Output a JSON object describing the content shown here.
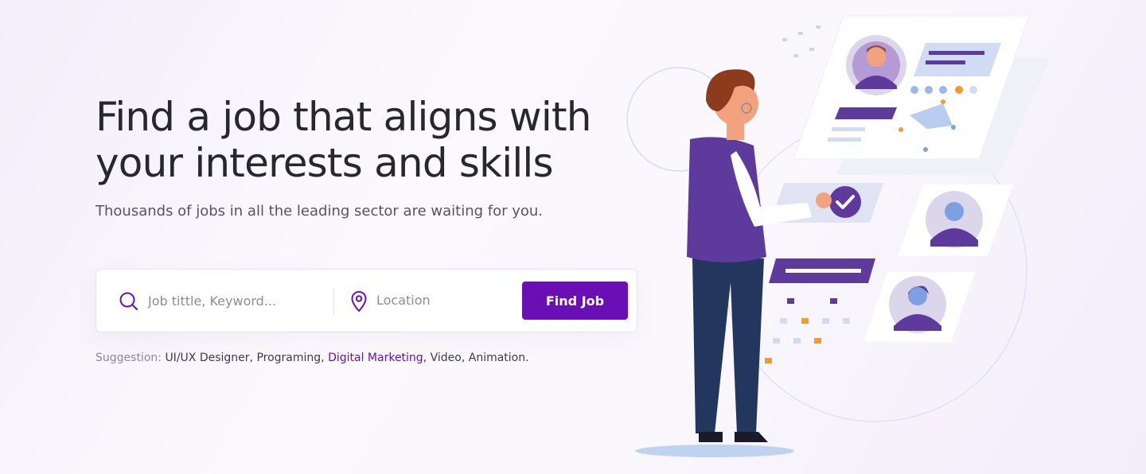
{
  "hero": {
    "headline_line1": "Find a job that aligns with",
    "headline_line2": "your interests and skills",
    "subline": "Thousands of jobs in all the leading sector are waiting for you."
  },
  "search": {
    "keyword_placeholder": "Job tittle, Keyword...",
    "location_placeholder": "Location",
    "button_label": "Find Job",
    "icons": {
      "keyword": "search-icon",
      "location": "map-pin-icon"
    }
  },
  "suggestion": {
    "label": "Suggestion:",
    "item1": "UI/UX Designer,",
    "item2": "Programing,",
    "item3": "Digital Marketing,",
    "item4": "Video,",
    "item5": "Animation."
  },
  "colors": {
    "accent": "#6a0fb5",
    "text_dark": "#27272e",
    "illustration_purple": "#5e3a9c",
    "illustration_orange": "#f39a2b",
    "illustration_blue": "#9bb8e8"
  }
}
